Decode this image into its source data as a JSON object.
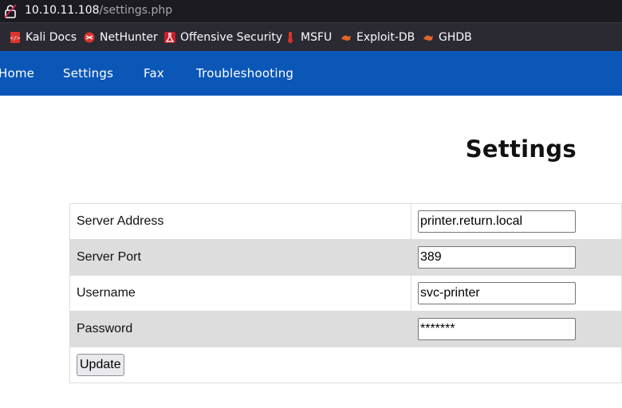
{
  "browser": {
    "url_host": "10.10.11.108",
    "url_path": "/settings.php",
    "bookmarks": [
      {
        "label": "Kali Docs",
        "icon": "kali-docs-icon"
      },
      {
        "label": "NetHunter",
        "icon": "nethunter-icon"
      },
      {
        "label": "Offensive Security",
        "icon": "offsec-icon"
      },
      {
        "label": "MSFU",
        "icon": "msfu-icon"
      },
      {
        "label": "Exploit-DB",
        "icon": "exploit-db-icon"
      },
      {
        "label": "GHDB",
        "icon": "ghdb-icon"
      }
    ]
  },
  "nav": {
    "items": [
      "Home",
      "Settings",
      "Fax",
      "Troubleshooting"
    ]
  },
  "page": {
    "title": "Settings"
  },
  "form": {
    "fields": [
      {
        "label": "Server Address",
        "value": "printer.return.local"
      },
      {
        "label": "Server Port",
        "value": "389"
      },
      {
        "label": "Username",
        "value": "svc-printer"
      },
      {
        "label": "Password",
        "value": "*******"
      }
    ],
    "submit_label": "Update"
  },
  "colors": {
    "nav_bg": "#0b57b8",
    "browser_bg": "#2b2a33",
    "row_alt": "#dddddd"
  }
}
